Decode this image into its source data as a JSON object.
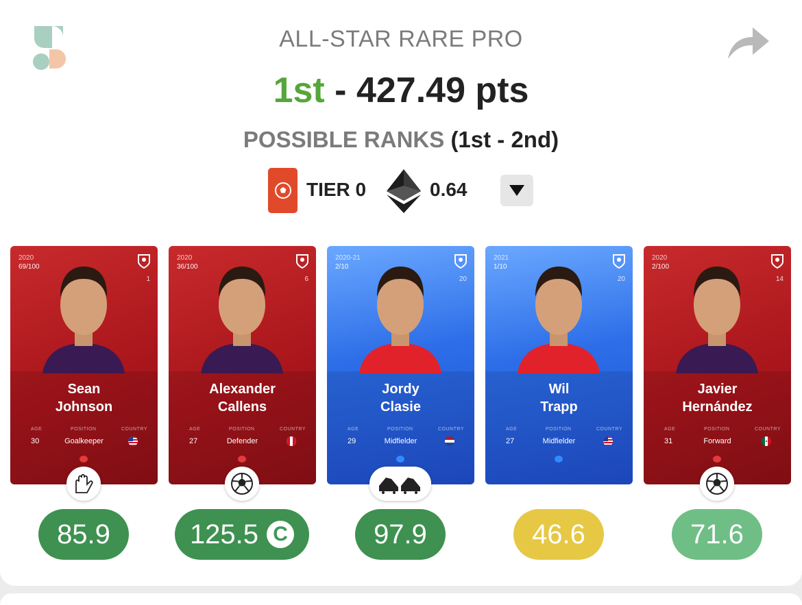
{
  "header": {
    "title": "ALL-STAR RARE PRO",
    "rank": "1st",
    "separator": " - ",
    "points": "427.49 pts",
    "possible_label": "POSSIBLE RANKS",
    "possible_range": "(1st - 2nd)"
  },
  "tier": {
    "label": "TIER 0",
    "eth_value": "0.64"
  },
  "colors": {
    "rank_green": "#55a63b",
    "tier_red": "#e04a2a",
    "score_green": "#3e9150",
    "score_yellow": "#e6c845",
    "score_light_green": "#6fbe86"
  },
  "cards": [
    {
      "season": "2020",
      "serial": "69/100",
      "shirt": "1",
      "first": "Sean",
      "last": "Johnson",
      "age": "30",
      "position": "Goalkeeper",
      "country": "usa",
      "style": "red",
      "stat_icon": "goalkeeper-gloves-icon",
      "score": "85.9",
      "score_color": "#3e9150",
      "captain": ""
    },
    {
      "season": "2020",
      "serial": "36/100",
      "shirt": "6",
      "first": "Alexander",
      "last": "Callens",
      "age": "27",
      "position": "Defender",
      "country": "peru",
      "style": "red",
      "stat_icon": "soccer-ball-icon",
      "score": "125.5",
      "score_color": "#3e9150",
      "captain": "C"
    },
    {
      "season": "2020-21",
      "serial": "2/10",
      "shirt": "20",
      "first": "Jordy",
      "last": "Clasie",
      "age": "29",
      "position": "Midfielder",
      "country": "netherlands",
      "style": "blue",
      "stat_icon": "football-boots-icon",
      "score": "97.9",
      "score_color": "#3e9150",
      "captain": ""
    },
    {
      "season": "2021",
      "serial": "1/10",
      "shirt": "20",
      "first": "Wil",
      "last": "Trapp",
      "age": "27",
      "position": "Midfielder",
      "country": "usa",
      "style": "blue",
      "stat_icon": "",
      "score": "46.6",
      "score_color": "#e6c845",
      "captain": ""
    },
    {
      "season": "2020",
      "serial": "2/100",
      "shirt": "14",
      "first": "Javier",
      "last": "Hernández",
      "age": "31",
      "position": "Forward",
      "country": "mexico",
      "style": "red",
      "stat_icon": "soccer-ball-icon",
      "score": "71.6",
      "score_color": "#6fbe86",
      "captain": ""
    }
  ],
  "card_labels": {
    "age": "AGE",
    "position": "POSITION",
    "country": "COUNTRY"
  }
}
